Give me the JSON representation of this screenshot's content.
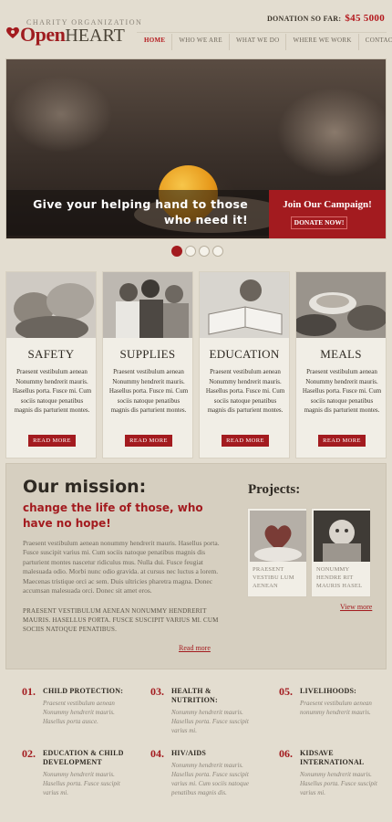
{
  "header": {
    "logo_sub": "CHARITY ORGANIZATION",
    "logo_main": "Open",
    "logo_main_rest": "HEART",
    "donation_label": "DONATION SO FAR:",
    "donation_value": "$45 5000"
  },
  "nav": {
    "items": [
      {
        "label": "HOME"
      },
      {
        "label": "WHO WE ARE"
      },
      {
        "label": "WHAT WE DO"
      },
      {
        "label": "WHERE WE WORK"
      },
      {
        "label": "CONTACTS"
      }
    ]
  },
  "hero": {
    "caption_line1": "Give your helping hand to those",
    "caption_line2": "who need it!",
    "campaign_title": "Join Our Campaign!",
    "campaign_button": "DONATE NOW!"
  },
  "slider": {
    "active_index": 0,
    "count": 4
  },
  "cards": [
    {
      "title": "SAFETY",
      "text": "Praesent vestibulum aenean Nonummy hendrerit mauris. Hasellus porta. Fusce mi. Cum sociis natoque penatibus magnis dis parturient montes.",
      "button": "READ MORE"
    },
    {
      "title": "SUPPLIES",
      "text": "Praesent vestibulum aenean Nonummy hendrerit mauris. Hasellus porta. Fusce mi. Cum sociis natoque penatibus magnis dis parturient montes.",
      "button": "READ MORE"
    },
    {
      "title": "EDUCATION",
      "text": "Praesent vestibulum aenean Nonummy hendrerit mauris. Hasellus porta. Fusce mi. Cum sociis natoque penatibus magnis dis parturient montes.",
      "button": "READ MORE"
    },
    {
      "title": "MEALS",
      "text": "Praesent vestibulum aenean Nonummy hendrerit mauris. Hasellus porta. Fusce mi. Cum sociis natoque penatibus magnis dis parturient montes.",
      "button": "READ MORE"
    }
  ],
  "mission": {
    "title": "Our mission:",
    "subtitle": "change the life of those, who have no hope!",
    "text": "Praesent vestibulum aenean nonummy hendrerit mauris. Hasellus porta. Fusce suscipit varius mi. Cum sociis natoque penatibus magnis dis parturient montes nascetur ridiculus mus. Nulla dui. Fusce feugiat malesuada odio. Morbi nunc odio gravida. at cursus nec luctus a lorem. Maecenas tristique orci ac sem. Duis ultricies pharetra magna. Donec accumsan malesuada orci. Donec sit amet eros.",
    "caps_text": "PRAESENT VESTIBULUM AENEAN NONUMMY HENDRERIT MAURIS. HASELLUS PORTA. FUSCE SUSCIPIT VARIUS MI. CUM SOCIIS NATOQUE PENATIBUS.",
    "read_more": "Read more"
  },
  "projects": {
    "title": "Projects:",
    "items": [
      {
        "text": "PRAESENT VESTIBU LUM AENEAN"
      },
      {
        "text": "NONUMMY HENDRE RIT MAURIS HASEL"
      }
    ],
    "view_more": "View more"
  },
  "bottom": [
    {
      "num": "01.",
      "head": "CHILD PROTECTION:",
      "text": "Praesent vestibulum aenean Nonummy hendrerit mauris. Hasellus porta ausce."
    },
    {
      "num": "03.",
      "head": "HEALTH & NUTRITION:",
      "text": "Nonummy hendrerit mauris. Hasellus porta. Fusce suscipit varius mi."
    },
    {
      "num": "05.",
      "head": "LIVELIHOODS:",
      "text": "Praesent vestibulum aenean nonummy hendrerit mauris."
    },
    {
      "num": "02.",
      "head": "EDUCATION & CHILD DEVELOPMENT",
      "text": "Nonummy hendrerit mauris. Hasellus porta. Fusce suscipit varius mi."
    },
    {
      "num": "04.",
      "head": "HIV/AIDS",
      "text": "Nonummy hendrerit mauris. Hasellus porta. Fusce suscipit varius mi. Cum sociis natoque penatibus magnis dis."
    },
    {
      "num": "06.",
      "head": "KIDSAVE INTERNATIONAL",
      "text": "Nonummy hendrerit mauris. Hasellus porta. Fusce suscipit varius mi."
    }
  ],
  "colors": {
    "accent": "#a31b1f",
    "background": "#e3ddd0",
    "panel": "#d6cfc0"
  }
}
